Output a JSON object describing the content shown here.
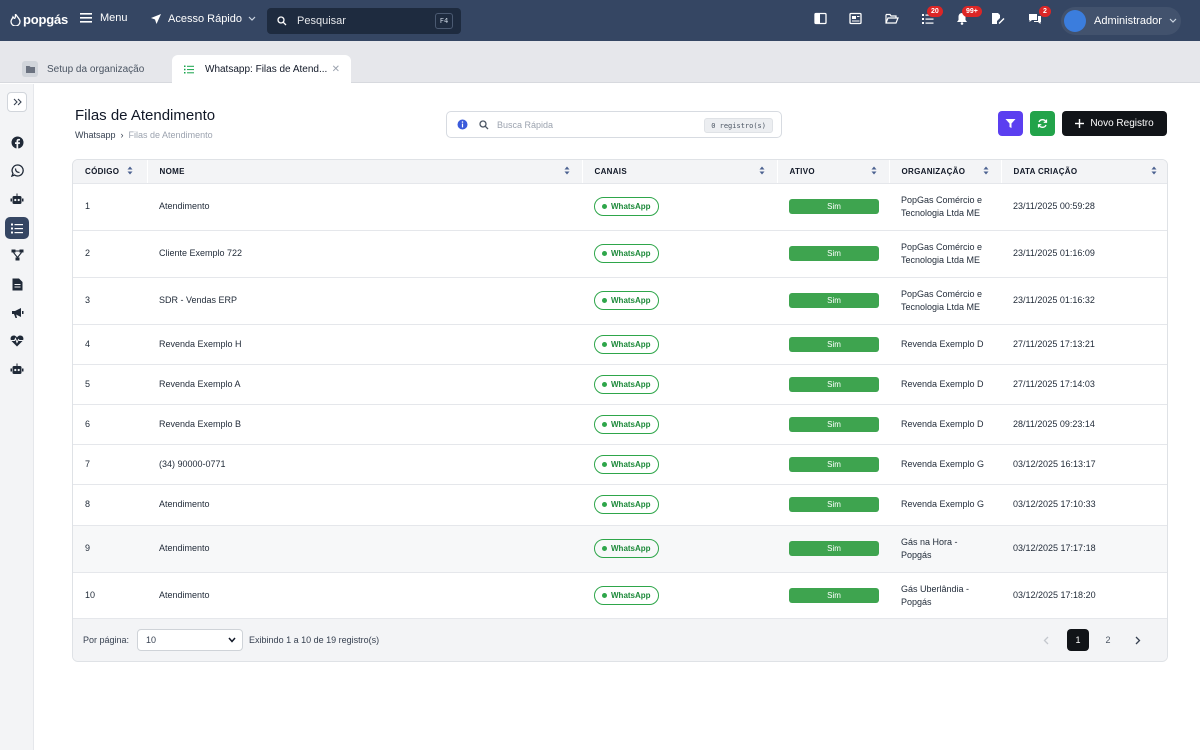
{
  "topbar": {
    "logo": "popgás",
    "menu_label": "Menu",
    "quick_access_label": "Acesso Rápido",
    "search_placeholder": "Pesquisar",
    "search_shortcut": "F4",
    "badges": {
      "tasks": "20",
      "notifications": "99+",
      "chat": "2"
    },
    "user_name": "Administrador"
  },
  "tabs": [
    {
      "label": "Setup da organização",
      "icon": "folder-icon",
      "active": false
    },
    {
      "label": "Whatsapp: Filas de Atend...",
      "icon": "list-icon",
      "active": true
    }
  ],
  "page": {
    "title": "Filas de Atendimento",
    "breadcrumb": [
      "Whatsapp",
      "Filas de Atendimento"
    ],
    "quick_search_placeholder": "Busca Rápida",
    "record_count": "0 registro(s)",
    "new_button": "Novo Registro"
  },
  "table": {
    "columns": [
      "CÓDIGO",
      "NOME",
      "CANAIS",
      "ATIVO",
      "ORGANIZAÇÃO",
      "DATA CRIAÇÃO"
    ],
    "rows": [
      {
        "codigo": "1",
        "nome": "Atendimento",
        "canal": "WhatsApp",
        "ativo": "Sim",
        "org": "PopGas Comércio e Tecnologia Ltda ME",
        "data": "23/11/2025 00:59:28"
      },
      {
        "codigo": "2",
        "nome": "Cliente Exemplo 722",
        "canal": "WhatsApp",
        "ativo": "Sim",
        "org": "PopGas Comércio e Tecnologia Ltda ME",
        "data": "23/11/2025 01:16:09"
      },
      {
        "codigo": "3",
        "nome": "SDR - Vendas ERP",
        "canal": "WhatsApp",
        "ativo": "Sim",
        "org": "PopGas Comércio e Tecnologia Ltda ME",
        "data": "23/11/2025 01:16:32"
      },
      {
        "codigo": "4",
        "nome": "Revenda Exemplo H",
        "canal": "WhatsApp",
        "ativo": "Sim",
        "org": "Revenda Exemplo D",
        "data": "27/11/2025 17:13:21"
      },
      {
        "codigo": "5",
        "nome": "Revenda Exemplo A",
        "canal": "WhatsApp",
        "ativo": "Sim",
        "org": "Revenda Exemplo D",
        "data": "27/11/2025 17:14:03"
      },
      {
        "codigo": "6",
        "nome": "Revenda Exemplo B",
        "canal": "WhatsApp",
        "ativo": "Sim",
        "org": "Revenda Exemplo D",
        "data": "28/11/2025 09:23:14"
      },
      {
        "codigo": "7",
        "nome": "(34) 90000-0771",
        "canal": "WhatsApp",
        "ativo": "Sim",
        "org": "Revenda Exemplo G",
        "data": "03/12/2025 16:13:17"
      },
      {
        "codigo": "8",
        "nome": "Atendimento",
        "canal": "WhatsApp",
        "ativo": "Sim",
        "org": "Revenda Exemplo G",
        "data": "03/12/2025 17:10:33"
      },
      {
        "codigo": "9",
        "nome": "Atendimento",
        "canal": "WhatsApp",
        "ativo": "Sim",
        "org": "Gás na Hora - Popgás",
        "data": "03/12/2025 17:17:18"
      },
      {
        "codigo": "10",
        "nome": "Atendimento",
        "canal": "WhatsApp",
        "ativo": "Sim",
        "org": "Gás Uberlândia - Popgás",
        "data": "03/12/2025 17:18:20"
      }
    ]
  },
  "footer": {
    "per_page_label": "Por página:",
    "per_page_value": "10",
    "showing": "Exibindo 1 a 10 de 19 registro(s)",
    "pages": [
      "1",
      "2"
    ],
    "current_page": "1"
  },
  "colors": {
    "topbar": "#354663",
    "accent_green": "#3ea44f",
    "filter_purple": "#5b3ff0",
    "primary_black": "#111418"
  }
}
